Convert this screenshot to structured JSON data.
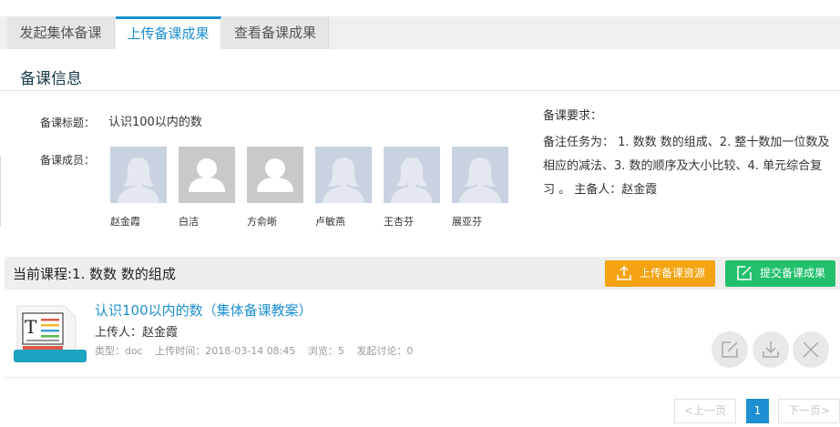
{
  "tabs": [
    {
      "label": "发起集体备课",
      "active": false
    },
    {
      "label": "上传备课成果",
      "active": true
    },
    {
      "label": "查看备课成果",
      "active": false
    }
  ],
  "section_title": "备课信息",
  "info": {
    "title_label": "备课标题：",
    "title_value": "认识100以内的数",
    "members_label": "备课成员："
  },
  "members": [
    {
      "name": "赵金霞",
      "avatar": "female-avatar"
    },
    {
      "name": "白洁",
      "avatar": "default-avatar"
    },
    {
      "name": "方俞晰",
      "avatar": "default-avatar"
    },
    {
      "name": "卢敏燕",
      "avatar": "female-avatar"
    },
    {
      "name": "王杏芬",
      "avatar": "female-avatar"
    },
    {
      "name": "展亚芬",
      "avatar": "female-avatar"
    }
  ],
  "requirements": {
    "label": "备课要求：",
    "text": "备注任务为：  1. 数数 数的组成、2. 整十数加一位数及相应的减法、3. 数的顺序及大小比较、4. 单元综合复习 。  主备人：赵金霞"
  },
  "course": {
    "title": "当前课程:1. 数数 数的组成",
    "upload_button": "上传备课资源",
    "submit_button": "提交备课成果"
  },
  "resource": {
    "title": "认识100以内的数（集体备课教案）",
    "uploader": "上传人：赵金霞",
    "type": "类型：doc",
    "upload_time": "上传时间：2018-03-14 08:45",
    "views": "浏览：5",
    "discussion": "发起讨论：0",
    "icon": "text-document-icon"
  },
  "pagination": {
    "prev": "<上一页",
    "current": "1",
    "next": "下一页>"
  },
  "colors": {
    "accent": "#1e8fd0",
    "upload": "#f4a312",
    "submit": "#22c06c"
  }
}
